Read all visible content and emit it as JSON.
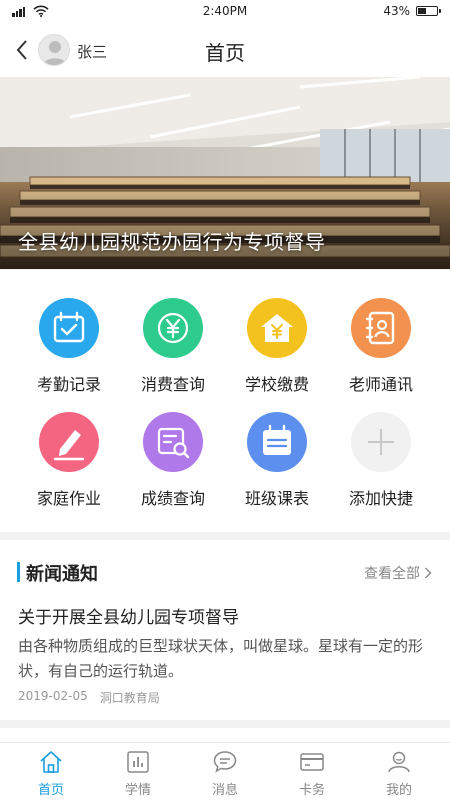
{
  "status_bar": {
    "time": "2:40PM",
    "battery": "43%",
    "battery_level": 0.43
  },
  "nav": {
    "username": "张三",
    "title": "首页"
  },
  "banner": {
    "title": "全县幼儿园规范办园行为专项督导"
  },
  "grid": {
    "items": [
      {
        "label": "考勤记录",
        "icon": "calendar-check-icon",
        "color": "#2aa8ee"
      },
      {
        "label": "消费查询",
        "icon": "yuan-icon",
        "color": "#2ecb8e"
      },
      {
        "label": "学校缴费",
        "icon": "house-yuan-icon",
        "color": "#f4c21f"
      },
      {
        "label": "老师通讯",
        "icon": "contacts-book-icon",
        "color": "#f3914f"
      },
      {
        "label": "家庭作业",
        "icon": "pencil-icon",
        "color": "#f46582"
      },
      {
        "label": "成绩查询",
        "icon": "document-search-icon",
        "color": "#b079ea"
      },
      {
        "label": "班级课表",
        "icon": "schedule-icon",
        "color": "#5c8fee"
      },
      {
        "label": "添加快捷",
        "icon": "plus-icon",
        "color": "#f1f1f1"
      }
    ]
  },
  "news": {
    "heading": "新闻通知",
    "view_all": "查看全部",
    "accent": "#1a9ee0",
    "items": [
      {
        "title": "关于开展全县幼儿园专项督导",
        "summary": "由各种物质组成的巨型球状天体，叫做星球。星球有一定的形状，有自己的运行轨道。",
        "date": "2019-02-05",
        "source": "洞口教育局"
      }
    ]
  },
  "tab_bar": {
    "active_color": "#1a9ee0",
    "tabs": [
      {
        "label": "首页",
        "icon": "home-icon",
        "active": true
      },
      {
        "label": "学情",
        "icon": "bar-chart-icon",
        "active": false
      },
      {
        "label": "消息",
        "icon": "message-icon",
        "active": false
      },
      {
        "label": "卡务",
        "icon": "card-icon",
        "active": false
      },
      {
        "label": "我的",
        "icon": "user-icon",
        "active": false
      }
    ]
  }
}
